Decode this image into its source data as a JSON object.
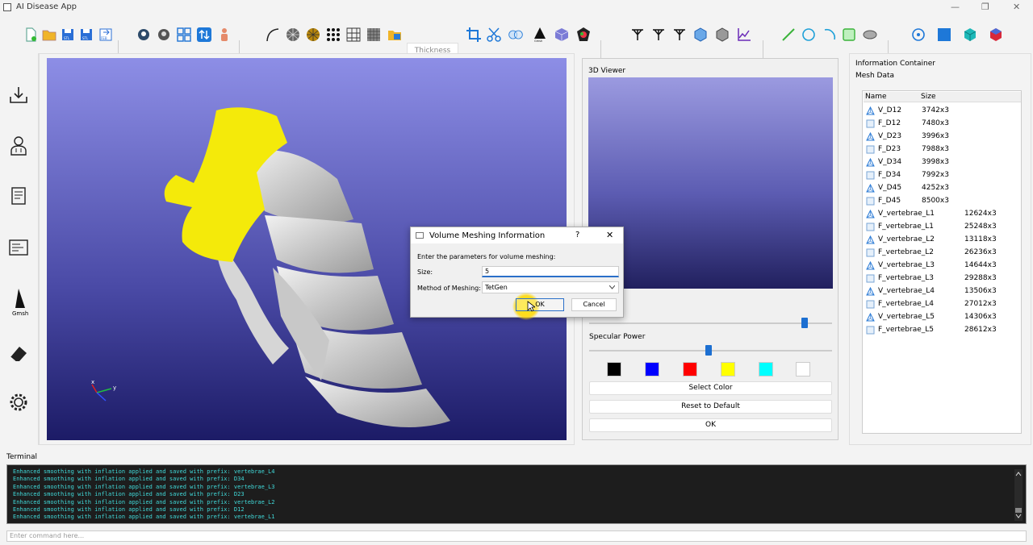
{
  "window": {
    "title": "AI Disease App",
    "minimize": "—",
    "maximize": "❐",
    "close": "✕"
  },
  "toolbar": {
    "thickness_placeholder": "Thickness"
  },
  "leftbar": {
    "gmsh_label": "Gmsh"
  },
  "viewer": {
    "title": "3D Viewer",
    "specular_power_label": "Specular Power",
    "swatch_colors": [
      "#000000",
      "#0000ff",
      "#ff0000",
      "#ffff00",
      "#00ffff",
      "#ffffff"
    ],
    "select_color_label": "Select Color",
    "reset_label": "Reset to Default",
    "ok_label": "OK"
  },
  "info": {
    "container_label": "Information Container",
    "mesh_label": "Mesh Data",
    "col_name": "Name",
    "col_size": "Size",
    "rows": [
      {
        "name": "V_D12",
        "size": "3742x3",
        "kind": "volume"
      },
      {
        "name": "F_D12",
        "size": "7480x3",
        "kind": "face"
      },
      {
        "name": "V_D23",
        "size": "3996x3",
        "kind": "volume"
      },
      {
        "name": "F_D23",
        "size": "7988x3",
        "kind": "face"
      },
      {
        "name": "V_D34",
        "size": "3998x3",
        "kind": "volume"
      },
      {
        "name": "F_D34",
        "size": "7992x3",
        "kind": "face"
      },
      {
        "name": "V_D45",
        "size": "4252x3",
        "kind": "volume"
      },
      {
        "name": "F_D45",
        "size": "8500x3",
        "kind": "face"
      },
      {
        "name": "V_vertebrae_L1",
        "size": "12624x3",
        "kind": "volume"
      },
      {
        "name": "F_vertebrae_L1",
        "size": "25248x3",
        "kind": "face"
      },
      {
        "name": "V_vertebrae_L2",
        "size": "13118x3",
        "kind": "volume"
      },
      {
        "name": "F_vertebrae_L2",
        "size": "26236x3",
        "kind": "face"
      },
      {
        "name": "V_vertebrae_L3",
        "size": "14644x3",
        "kind": "volume"
      },
      {
        "name": "F_vertebrae_L3",
        "size": "29288x3",
        "kind": "face"
      },
      {
        "name": "V_vertebrae_L4",
        "size": "13506x3",
        "kind": "volume"
      },
      {
        "name": "F_vertebrae_L4",
        "size": "27012x3",
        "kind": "face"
      },
      {
        "name": "V_vertebrae_L5",
        "size": "14306x3",
        "kind": "volume"
      },
      {
        "name": "F_vertebrae_L5",
        "size": "28612x3",
        "kind": "face"
      }
    ]
  },
  "terminal": {
    "label": "Terminal",
    "lines": [
      "Enhanced smoothing with inflation applied and saved with prefix: vertebrae_L4",
      "Enhanced smoothing with inflation applied and saved with prefix: D34",
      "Enhanced smoothing with inflation applied and saved with prefix: vertebrae_L3",
      "Enhanced smoothing with inflation applied and saved with prefix: D23",
      "Enhanced smoothing with inflation applied and saved with prefix: vertebrae_L2",
      "Enhanced smoothing with inflation applied and saved with prefix: D12",
      "Enhanced smoothing with inflation applied and saved with prefix: vertebrae_L1"
    ],
    "command_placeholder": "Enter command here..."
  },
  "dialog": {
    "title": "Volume Meshing Information",
    "help": "?",
    "close": "✕",
    "prompt": "Enter the parameters for volume meshing:",
    "size_label": "Size:",
    "size_value": "5",
    "method_label": "Method of Meshing:",
    "method_value": "TetGen",
    "ok_label": "OK",
    "cancel_label": "Cancel"
  },
  "axes": {
    "x": "x",
    "y": "y",
    "z": "z"
  }
}
